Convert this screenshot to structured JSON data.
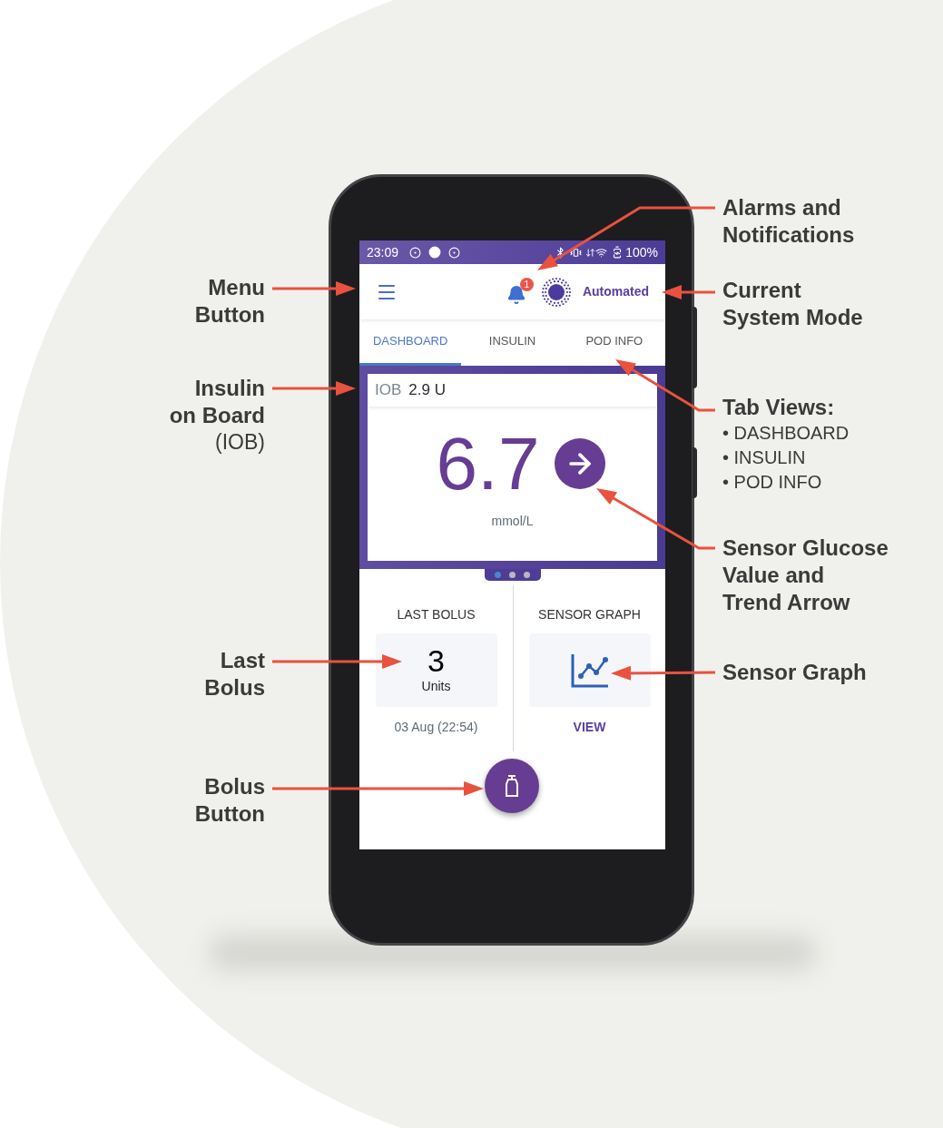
{
  "status_bar": {
    "time": "23:09",
    "battery": "100%"
  },
  "header": {
    "notification_count": "1",
    "mode": "Automated"
  },
  "tabs": [
    {
      "label": "DASHBOARD",
      "selected": true
    },
    {
      "label": "INSULIN",
      "selected": false
    },
    {
      "label": "POD INFO",
      "selected": false
    }
  ],
  "iob": {
    "label": "IOB",
    "value": "2.9 U"
  },
  "glucose": {
    "value": "6.7",
    "unit": "mmol/L"
  },
  "carousel_dots": [
    {
      "selected": true
    },
    {
      "selected": false
    },
    {
      "selected": false
    }
  ],
  "last_bolus": {
    "title": "LAST BOLUS",
    "value": "3",
    "unit": "Units",
    "time": "03 Aug (22:54)"
  },
  "sensor_graph": {
    "title": "SENSOR GRAPH",
    "link": "VIEW"
  },
  "left_callouts": [
    {
      "lines": [
        "Menu",
        "Button"
      ]
    },
    {
      "lines": [
        "Insulin",
        "on Board"
      ],
      "note": "(IOB)"
    },
    {
      "lines": [
        "Last",
        "Bolus"
      ]
    },
    {
      "lines": [
        "Bolus",
        "Button"
      ]
    }
  ],
  "right_callouts": [
    {
      "lines": [
        "Alarms and",
        "Notifications"
      ]
    },
    {
      "lines": [
        "Current",
        "System Mode"
      ]
    },
    {
      "lines": [
        "Tab Views:"
      ],
      "items": [
        "• DASHBOARD",
        "• INSULIN",
        "• POD INFO"
      ]
    },
    {
      "lines": [
        "Sensor Glucose",
        "Value and",
        "Trend Arrow"
      ]
    },
    {
      "lines": [
        "Sensor Graph"
      ]
    }
  ]
}
